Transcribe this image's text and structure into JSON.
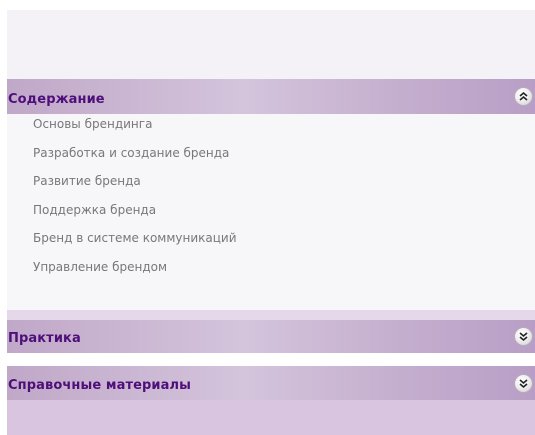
{
  "sections": [
    {
      "title": "Содержание",
      "expanded": true,
      "toggle_icon": "chevron-double-up-icon",
      "items": [
        "Основы брендинга",
        "Разработка и создание бренда",
        "Развитие бренда",
        "Поддержка бренда",
        "Бренд в системе коммуникаций",
        "Управление брендом"
      ]
    },
    {
      "title": "Практика",
      "expanded": false,
      "toggle_icon": "chevron-double-down-icon"
    },
    {
      "title": "Справочные материалы",
      "expanded": false,
      "toggle_icon": "chevron-double-down-icon"
    }
  ],
  "colors": {
    "header_text": "#4e0f7a",
    "item_text": "#787878",
    "header_bg": "#c4aece",
    "panel_bg": "#f4f2f7"
  }
}
